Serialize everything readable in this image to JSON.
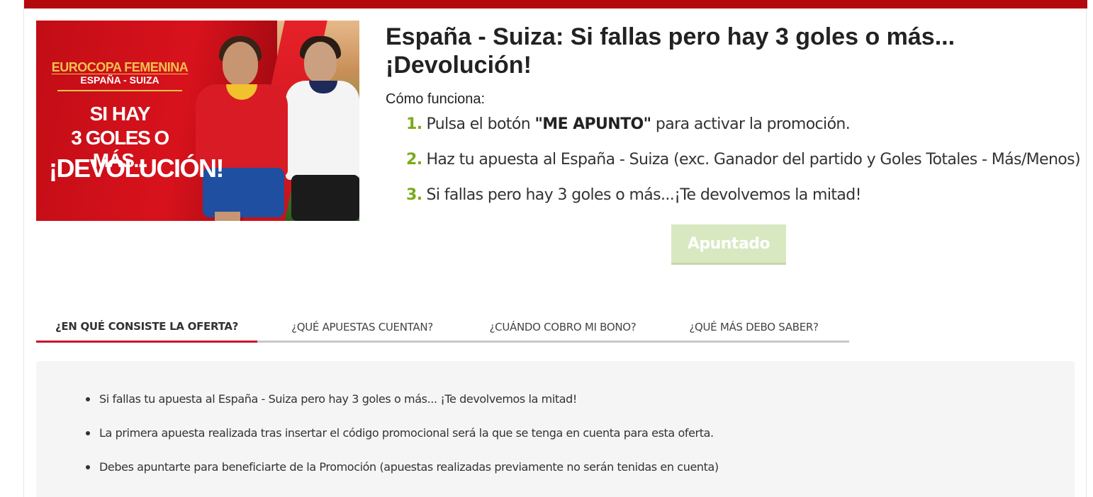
{
  "banner": {
    "event": "EUROCOPA FEMENINA",
    "match": "ESPAÑA - SUIZA",
    "line1": "SI HAY",
    "line2": "3 GOLES O MÁS...",
    "line3": "¡DEVOLUCIÓN!"
  },
  "promo": {
    "title_line1": "España - Suiza: Si fallas pero hay 3 goles o más...",
    "title_line2": "¡Devolución!",
    "how_it_works": "Cómo funciona:",
    "steps": [
      {
        "num": "1.",
        "pre": "Pulsa el botón ",
        "strong": "\"ME APUNTO\"",
        "post": " para activar la promoción."
      },
      {
        "num": "2.",
        "text": "Haz tu apuesta al España - Suiza (exc. Ganador del partido y Goles Totales - Más/Menos)"
      },
      {
        "num": "3.",
        "text": "Si fallas pero hay 3 goles o más...¡Te devolvemos la mitad!"
      }
    ],
    "button_label": "Apuntado"
  },
  "colors": {
    "brand_red": "#b4080f",
    "step_number_green": "#7aaa1b",
    "button_disabled": "#d8e8c1"
  },
  "tabs": [
    {
      "label": "¿EN QUÉ CONSISTE LA OFERTA?",
      "active": true
    },
    {
      "label": "¿QUÉ APUESTAS CUENTAN?",
      "active": false
    },
    {
      "label": "¿CUÁNDO COBRO MI BONO?",
      "active": false
    },
    {
      "label": "¿QUÉ MÁS DEBO SABER?",
      "active": false
    }
  ],
  "details": [
    "Si fallas tu apuesta al España - Suiza pero hay 3 goles o más... ¡Te devolvemos la mitad!",
    "La primera apuesta realizada tras insertar el código promocional será la que se tenga en cuenta para esta oferta.",
    "Debes apuntarte para beneficiarte de la Promoción (apuestas realizadas previamente no serán tenidas en cuenta)"
  ]
}
